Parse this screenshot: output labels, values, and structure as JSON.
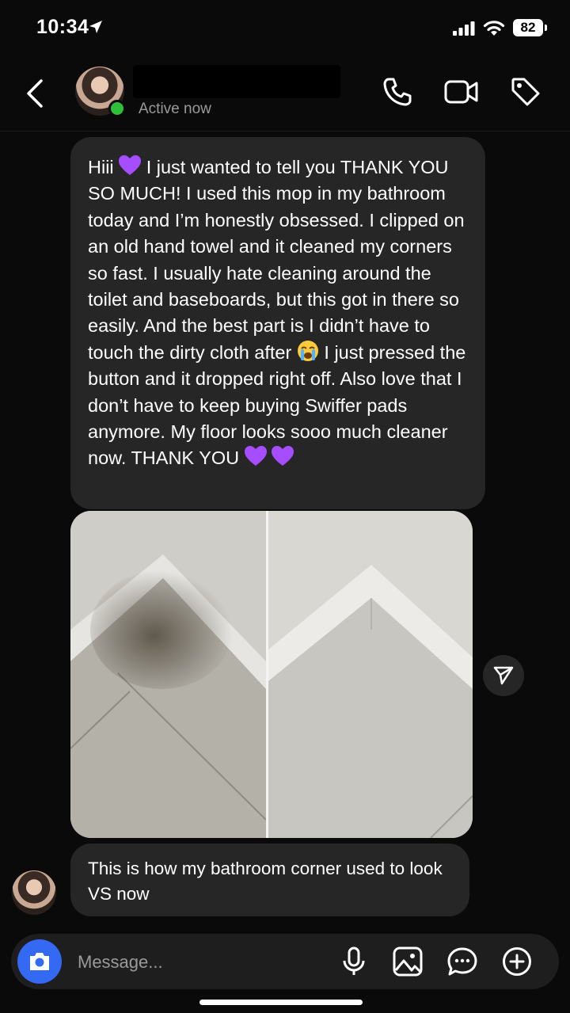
{
  "status_bar": {
    "time": "10:34",
    "battery": "82",
    "icons": [
      "location-arrow-icon",
      "signal-icon",
      "wifi-icon",
      "battery-icon"
    ]
  },
  "header": {
    "status": "Active now",
    "icons": [
      "back-icon",
      "phone-icon",
      "video-icon",
      "tag-icon"
    ],
    "online_color": "#2fbf3a"
  },
  "messages": [
    {
      "text_a": "Hiii ",
      "text_b": " I just wanted to tell you THANK YOU SO MUCH! I used this mop in my bathroom today and I’m honestly obsessed. I clipped on an old hand towel and it cleaned my corners so fast. I usually hate cleaning around the toilet and baseboards, but this got in there so easily. And the best part is I didn’t have to touch the dirty cloth after ",
      "text_c": " I just pressed the button and it dropped right off. Also love that I don’t have to keep buying Swiffer pads anymore. My floor looks sooo much cleaner now. THANK YOU ",
      "emoji": [
        "purple-heart",
        "loudly-crying-face",
        "purple-heart",
        "purple-heart"
      ]
    },
    {
      "type": "photo",
      "description_icon": "before-after-photo"
    },
    {
      "text": "This is how my bathroom corner used to look VS now"
    }
  ],
  "composer": {
    "placeholder": "Message...",
    "icons": [
      "camera-icon",
      "microphone-icon",
      "gallery-icon",
      "sticker-icon",
      "plus-icon"
    ],
    "accent": "#3469f4"
  },
  "colors": {
    "background": "#0a0a0a",
    "bubble": "#262626",
    "heart": "#a64dff"
  }
}
